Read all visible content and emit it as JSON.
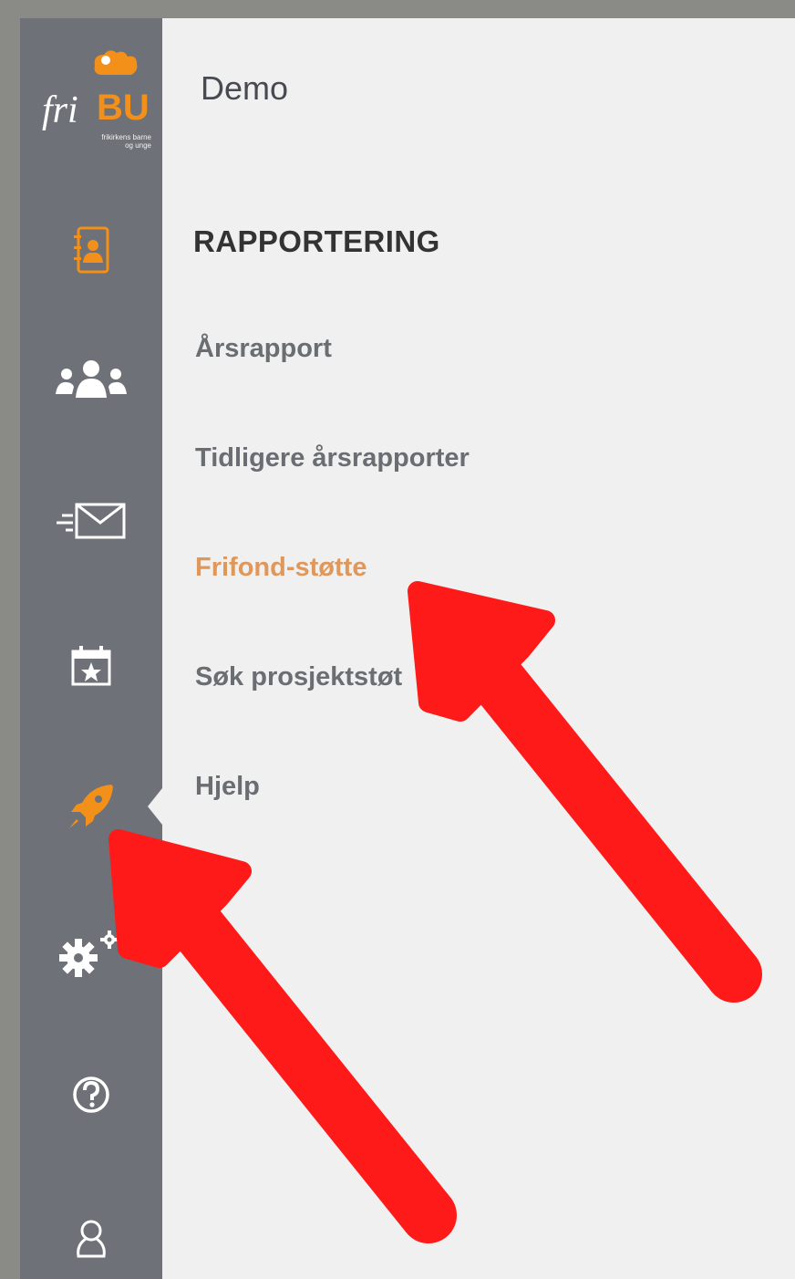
{
  "app": {
    "header_title": "Demo",
    "logo": {
      "text_fri": "fri",
      "text_bu": "BU",
      "subtitle": "frikirkens barne og unge"
    }
  },
  "sidebar": {
    "icons": [
      {
        "name": "contacts-icon",
        "active": false
      },
      {
        "name": "people-icon",
        "active": false
      },
      {
        "name": "send-mail-icon",
        "active": false
      },
      {
        "name": "calendar-star-icon",
        "active": false
      },
      {
        "name": "rocket-icon",
        "active": true
      },
      {
        "name": "gears-icon",
        "active": false
      },
      {
        "name": "help-icon",
        "active": false
      },
      {
        "name": "user-icon",
        "active": false
      }
    ]
  },
  "submenu": {
    "section_title": "RAPPORTERING",
    "items": [
      {
        "label": "Årsrapport",
        "active": false
      },
      {
        "label": "Tidligere årsrapporter",
        "active": false
      },
      {
        "label": "Frifond-støtte",
        "active": true
      },
      {
        "label": "Søk prosjektstøt",
        "active": false
      },
      {
        "label": "Hjelp",
        "active": false
      }
    ]
  },
  "colors": {
    "accent": "#f39019",
    "active_menu": "#e0975a",
    "sidebar_bg": "#6e7177",
    "annotation_arrow": "#ff1a1a"
  }
}
